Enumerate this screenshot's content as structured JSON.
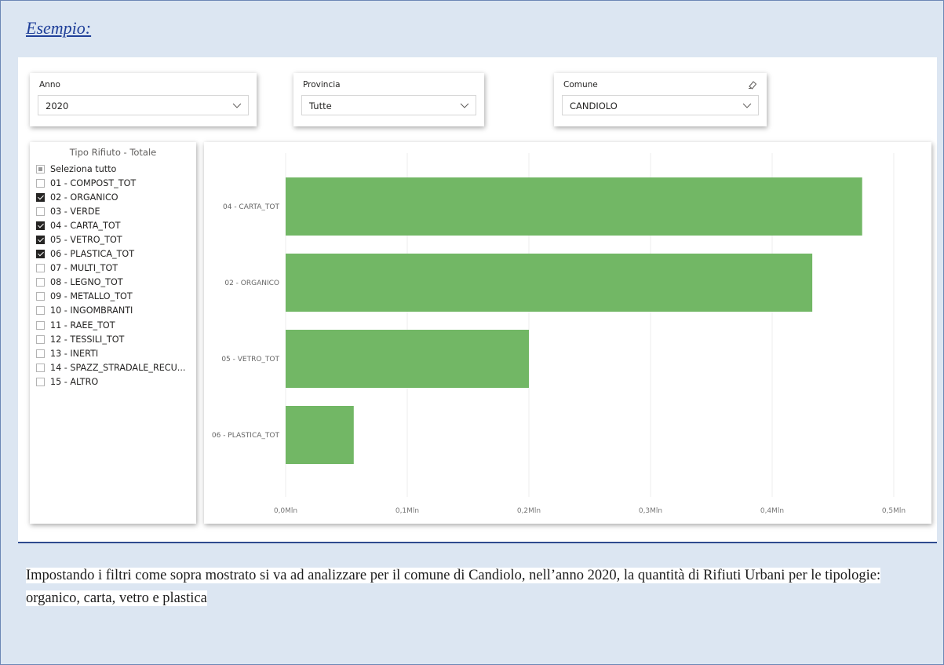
{
  "heading": "Esempio:",
  "slicers": {
    "anno": {
      "label": "Anno",
      "value": "2020"
    },
    "provincia": {
      "label": "Provincia",
      "value": "Tutte"
    },
    "comune": {
      "label": "Comune",
      "value": "CANDIOLO"
    }
  },
  "rifiuto_list": {
    "title": "Tipo Rifiuto - Totale",
    "items": [
      {
        "label": "Seleziona tutto",
        "state": "partial"
      },
      {
        "label": "01 - COMPOST_TOT",
        "state": "unchecked"
      },
      {
        "label": "02 - ORGANICO",
        "state": "checked"
      },
      {
        "label": "03 - VERDE",
        "state": "unchecked"
      },
      {
        "label": "04 - CARTA_TOT",
        "state": "checked"
      },
      {
        "label": "05 - VETRO_TOT",
        "state": "checked"
      },
      {
        "label": "06 - PLASTICA_TOT",
        "state": "checked"
      },
      {
        "label": "07 - MULTI_TOT",
        "state": "unchecked"
      },
      {
        "label": "08 - LEGNO_TOT",
        "state": "unchecked"
      },
      {
        "label": "09 - METALLO_TOT",
        "state": "unchecked"
      },
      {
        "label": "10 - INGOMBRANTI",
        "state": "unchecked"
      },
      {
        "label": "11 - RAEE_TOT",
        "state": "unchecked"
      },
      {
        "label": "12 - TESSILI_TOT",
        "state": "unchecked"
      },
      {
        "label": "13 - INERTI",
        "state": "unchecked"
      },
      {
        "label": "14 - SPAZZ_STRADALE_RECU...",
        "state": "unchecked"
      },
      {
        "label": "15 - ALTRO",
        "state": "unchecked"
      }
    ]
  },
  "chart_data": {
    "type": "bar",
    "orientation": "horizontal",
    "categories": [
      "04 - CARTA_TOT",
      "02 - ORGANICO",
      "05 - VETRO_TOT",
      "06 - PLASTICA_TOT"
    ],
    "values": [
      0.474,
      0.433,
      0.2,
      0.056
    ],
    "unit": "Mln",
    "xlim": [
      0,
      0.5
    ],
    "xticks": [
      "0,0Mln",
      "0,1Mln",
      "0,2Mln",
      "0,3Mln",
      "0,4Mln",
      "0,5Mln"
    ],
    "grid": true,
    "bar_color": "#72b765"
  },
  "caption": "Impostando i filtri come sopra mostrato si va ad analizzare per il comune di Candiolo, nell’anno 2020, la quantità di Rifiuti Urbani per le tipologie: organico, carta, vetro e plastica"
}
